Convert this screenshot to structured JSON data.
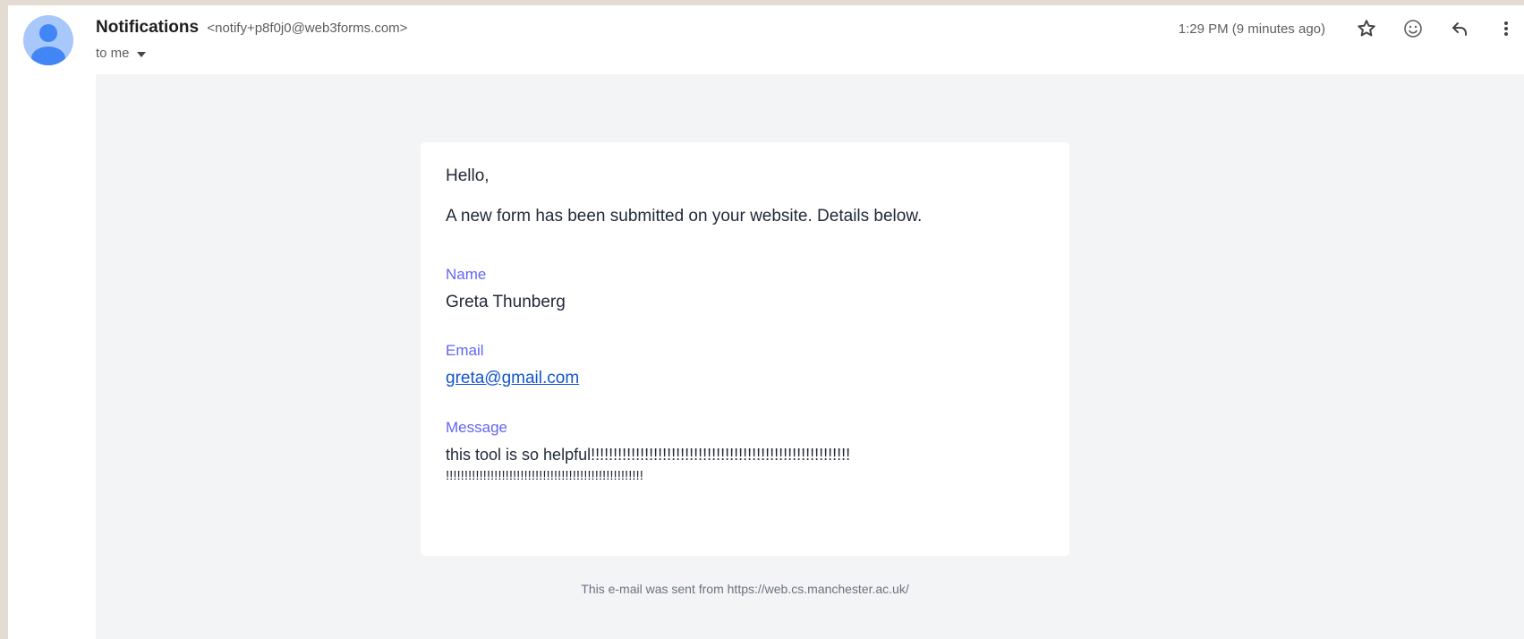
{
  "header": {
    "sender_name": "Notifications",
    "sender_email": "<notify+p8f0j0@web3forms.com>",
    "to_label": "to me",
    "timestamp": "1:29 PM (9 minutes ago)"
  },
  "icons": {
    "avatar": "person-avatar-icon",
    "star": "star-icon",
    "emoji": "emoji-icon",
    "reply": "reply-icon",
    "more": "more-vert-icon",
    "caret": "caret-down-icon"
  },
  "email": {
    "greeting": "Hello,",
    "intro": "A new form has been submitted on your website. Details below.",
    "fields": [
      {
        "label": "Name",
        "value": "Greta Thunberg"
      },
      {
        "label": "Email",
        "value": "greta@gmail.com"
      },
      {
        "label": "Message",
        "value_line1": "this tool is so helpful!!!!!!!!!!!!!!!!!!!!!!!!!!!!!!!!!!!!!!!!!!!!!!!!!!!!!!!!!!",
        "value_line2": "!!!!!!!!!!!!!!!!!!!!!!!!!!!!!!!!!!!!!!!!!!!!!!!!!!!!!"
      }
    ],
    "footer": "This e-mail was sent from https://web.cs.manchester.ac.uk/"
  },
  "colors": {
    "avatar_bg": "#a8c7fa",
    "avatar_fg": "#4285f4",
    "label": "#6366f1",
    "link": "#1155cc",
    "message_bg": "#f3f4f6"
  }
}
